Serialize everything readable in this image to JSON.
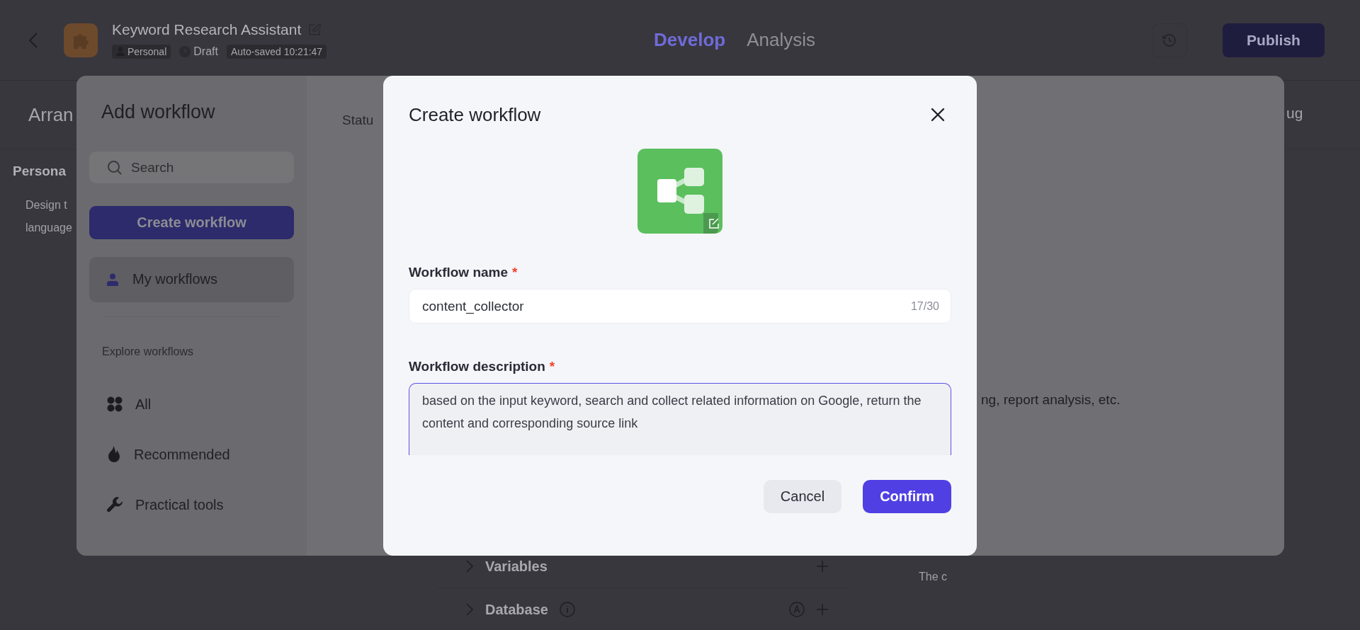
{
  "header": {
    "title": "Keyword Research Assistant",
    "tags": [
      {
        "kind": "scope",
        "label": "Personal"
      },
      {
        "kind": "status",
        "label": "Draft"
      },
      {
        "kind": "saved",
        "label": "Auto-saved 10:21:47"
      }
    ],
    "tabs": [
      {
        "label": "Develop",
        "selected": true
      },
      {
        "label": "Analysis",
        "selected": false
      }
    ],
    "publish": "Publish"
  },
  "background": {
    "section_title": "Arran",
    "persona_heading": "Persona",
    "persona_lines": [
      "Design t",
      "language"
    ],
    "debug_fragment": "ug",
    "panels": [
      {
        "label": "Variables",
        "info": false,
        "auto": false
      },
      {
        "label": "Database",
        "info": true,
        "auto": true
      }
    ],
    "note_fragment": "The c"
  },
  "add_workflow": {
    "title": "Add workflow",
    "search": {
      "placeholder": "Search"
    },
    "create_button": "Create workflow",
    "my_workflows": {
      "label": "My workflows",
      "selected": true
    },
    "explore_heading": "Explore workflows",
    "categories": [
      {
        "kind": "all",
        "label": "All",
        "selected": false
      },
      {
        "kind": "recommended",
        "label": "Recommended",
        "selected": false
      },
      {
        "kind": "tools",
        "label": "Practical tools",
        "selected": false
      }
    ],
    "status_fragment": "Statu",
    "description_fragment": "ng, report analysis, etc."
  },
  "create_workflow": {
    "title": "Create workflow",
    "name": {
      "label": "Workflow name",
      "required_mark": "*",
      "value": "content_collector",
      "counter": "17/30"
    },
    "description": {
      "label": "Workflow description",
      "required_mark": "*",
      "value": "based on the input keyword, search and collect related information on Google, return the content and corresponding source link"
    },
    "buttons": [
      {
        "kind": "secondary",
        "label": "Cancel"
      },
      {
        "kind": "primary",
        "label": "Confirm"
      }
    ]
  }
}
